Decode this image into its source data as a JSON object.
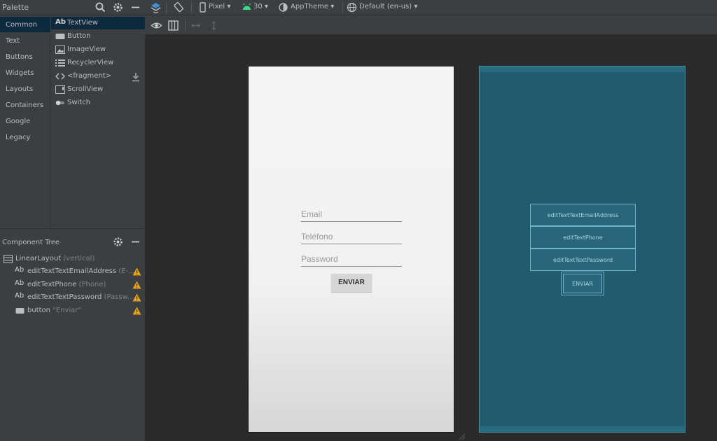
{
  "palette": {
    "title": "Palette",
    "categories": [
      "Common",
      "Text",
      "Buttons",
      "Widgets",
      "Layouts",
      "Containers",
      "Google",
      "Legacy"
    ],
    "selected_category": "Common",
    "items": [
      {
        "label": "TextView",
        "icon": "textview-icon"
      },
      {
        "label": "Button",
        "icon": "button-icon"
      },
      {
        "label": "ImageView",
        "icon": "imageview-icon"
      },
      {
        "label": "RecyclerView",
        "icon": "recyclerview-icon"
      },
      {
        "label": "<fragment>",
        "icon": "fragment-icon"
      },
      {
        "label": "ScrollView",
        "icon": "scrollview-icon"
      },
      {
        "label": "Switch",
        "icon": "switch-icon"
      }
    ],
    "textview_prefix": "Ab"
  },
  "toolbar": {
    "device": "Pixel",
    "api": "30",
    "theme": "AppTheme",
    "locale": "Default (en-us)"
  },
  "component_tree": {
    "title": "Component Tree",
    "rows": [
      {
        "label": "LinearLayout",
        "sub": "(vertical)",
        "warn": false
      },
      {
        "label": "editTextTextEmailAddress",
        "sub": "(E-...",
        "warn": true
      },
      {
        "label": "editTextPhone",
        "sub": "(Phone)",
        "warn": true
      },
      {
        "label": "editTextTextPassword",
        "sub": "(Passw...",
        "warn": true
      },
      {
        "label": "button",
        "sub": "\"Enviar\"",
        "warn": true
      }
    ]
  },
  "design": {
    "email_hint": "Email",
    "phone_hint": "Teléfono",
    "password_hint": "Password",
    "button_label": "ENVIAR"
  },
  "blueprint": {
    "email_id": "editTextTextEmailAddress",
    "phone_id": "editTextPhone",
    "password_id": "editTextTextPassword",
    "button_label": "ENVIAR"
  },
  "colors": {
    "selection": "#0d293e",
    "blueprint_bg": "#235b6e",
    "warning": "#e8a317",
    "android_green": "#3ddc84"
  }
}
